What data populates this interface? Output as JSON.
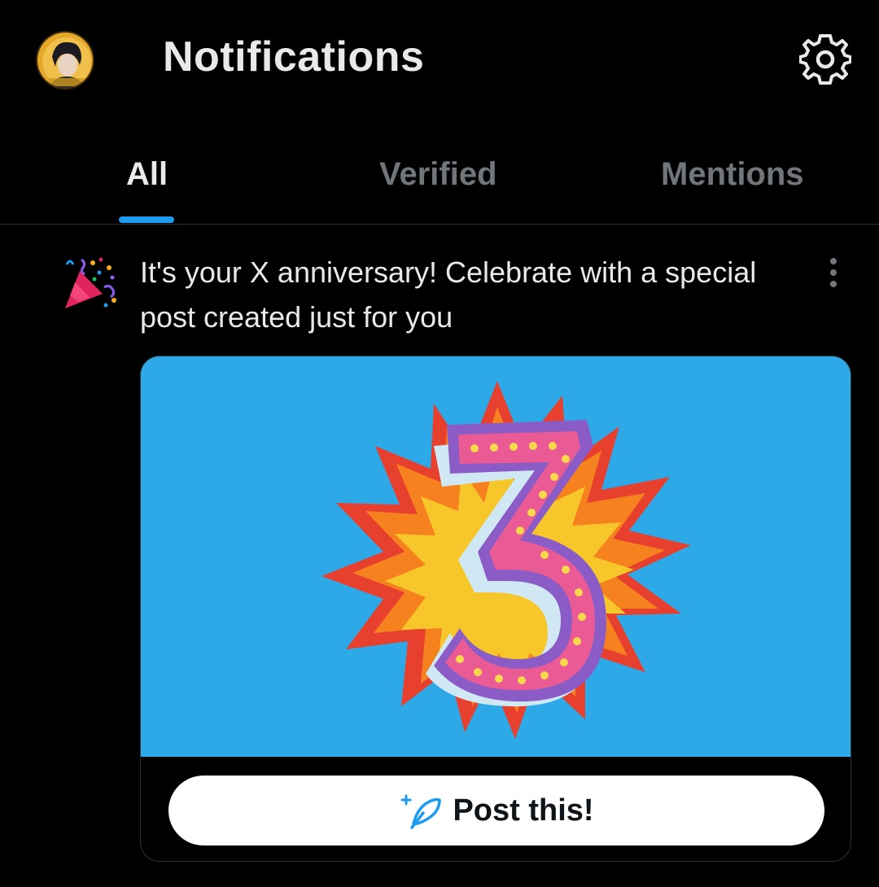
{
  "header": {
    "title": "Notifications",
    "avatar_icon": "user-avatar",
    "settings_icon": "gear-icon"
  },
  "tabs": [
    {
      "label": "All",
      "active": true
    },
    {
      "label": "Verified",
      "active": false
    },
    {
      "label": "Mentions",
      "active": false
    }
  ],
  "notification": {
    "icon": "party-popper-icon",
    "text": "It's your X anniversary! Celebrate with a special post created just for you",
    "menu_icon": "more-vertical-icon",
    "card": {
      "image_icon": "anniversary-number-3-image",
      "button_label": "Post this!",
      "button_icon": "compose-feather-icon"
    }
  },
  "colors": {
    "background": "#000000",
    "accent": "#1d9bf0",
    "text_primary": "#e7e9ea",
    "text_secondary": "#71767b",
    "card_image_bg": "#2ea9e8"
  }
}
